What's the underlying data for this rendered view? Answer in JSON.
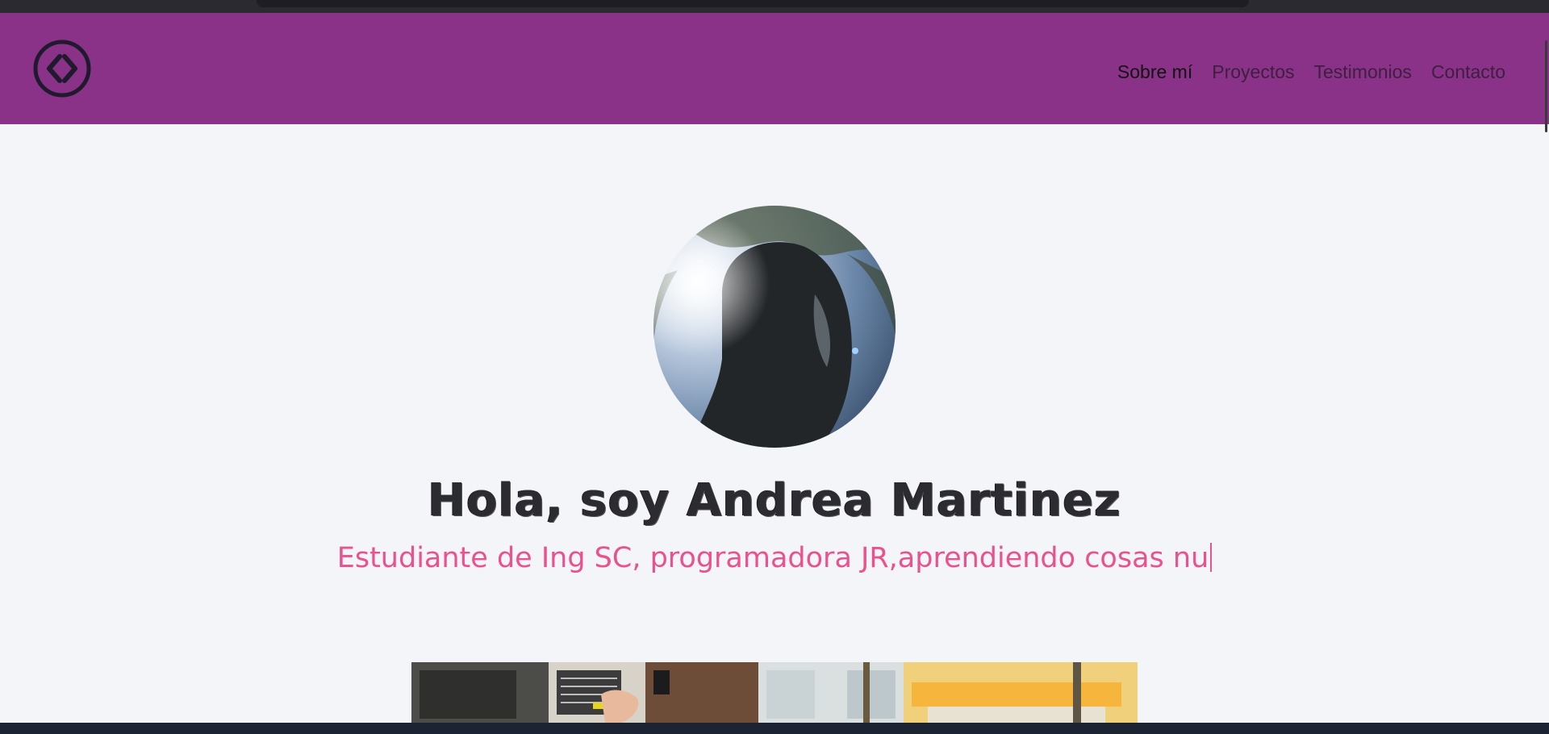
{
  "nav": {
    "logo_icon": "code-brackets-icon",
    "links": [
      {
        "label": "Sobre mí",
        "active": true
      },
      {
        "label": "Proyectos",
        "active": false
      },
      {
        "label": "Testimonios",
        "active": false
      },
      {
        "label": "Contacto",
        "active": false
      }
    ]
  },
  "hero": {
    "avatar_alt": "profile photo",
    "title": "Hola, soy Andrea Martinez",
    "subtitle": "Estudiante de Ing SC, programadora JR,aprendiendo cosas nu"
  },
  "colors": {
    "navbar": "#8a3287",
    "accent": "#e9518f",
    "background": "#f4f5f8"
  }
}
